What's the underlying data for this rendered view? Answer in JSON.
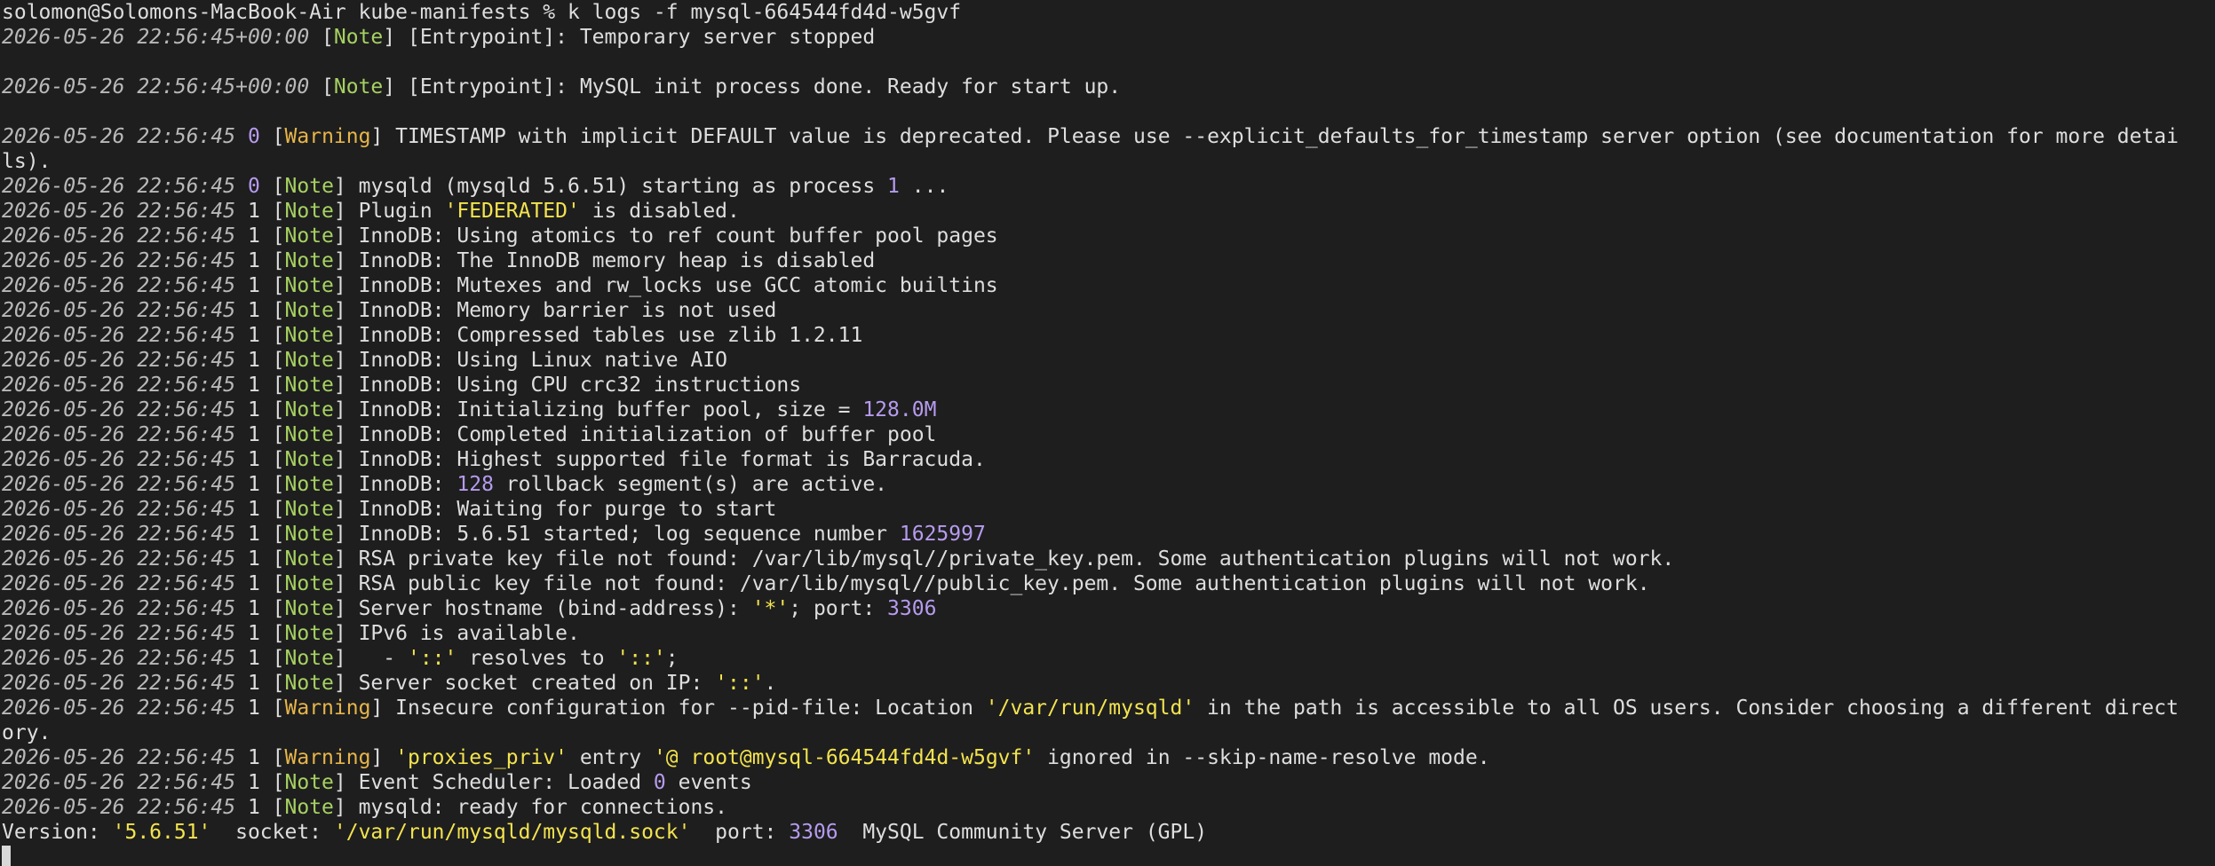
{
  "terminal": {
    "lines": [
      {
        "segments": [
          {
            "t": "text",
            "v": "solomon@Solomons-MacBook-Air kube-manifests % k logs -f mysql-664544fd4d-w5gvf"
          }
        ]
      },
      {
        "segments": [
          {
            "t": "ts",
            "v": "2026-05-26 22:56:45+00:00"
          },
          {
            "t": "text",
            "v": " ["
          },
          {
            "t": "note",
            "v": "Note"
          },
          {
            "t": "text",
            "v": "] [Entrypoint]: Temporary server stopped"
          }
        ]
      },
      {
        "segments": []
      },
      {
        "segments": [
          {
            "t": "ts",
            "v": "2026-05-26 22:56:45+00:00"
          },
          {
            "t": "text",
            "v": " ["
          },
          {
            "t": "note",
            "v": "Note"
          },
          {
            "t": "text",
            "v": "] [Entrypoint]: MySQL init process done. Ready for start up."
          }
        ]
      },
      {
        "segments": []
      },
      {
        "segments": [
          {
            "t": "ts",
            "v": "2026-05-26 22:56:45"
          },
          {
            "t": "text",
            "v": " "
          },
          {
            "t": "num",
            "v": "0"
          },
          {
            "t": "text",
            "v": " ["
          },
          {
            "t": "warn",
            "v": "Warning"
          },
          {
            "t": "text",
            "v": "] TIMESTAMP with implicit DEFAULT value is deprecated. Please use --explicit_defaults_for_timestamp server option (see documentation for more detai"
          }
        ]
      },
      {
        "segments": [
          {
            "t": "text",
            "v": "ls)."
          }
        ]
      },
      {
        "segments": [
          {
            "t": "ts",
            "v": "2026-05-26 22:56:45"
          },
          {
            "t": "text",
            "v": " "
          },
          {
            "t": "num",
            "v": "0"
          },
          {
            "t": "text",
            "v": " ["
          },
          {
            "t": "note",
            "v": "Note"
          },
          {
            "t": "text",
            "v": "] mysqld (mysqld 5.6.51) starting as process "
          },
          {
            "t": "num",
            "v": "1"
          },
          {
            "t": "text",
            "v": " ..."
          }
        ]
      },
      {
        "segments": [
          {
            "t": "ts",
            "v": "2026-05-26 22:56:45"
          },
          {
            "t": "text",
            "v": " 1 ["
          },
          {
            "t": "note",
            "v": "Note"
          },
          {
            "t": "text",
            "v": "] Plugin "
          },
          {
            "t": "str",
            "v": "'FEDERATED'"
          },
          {
            "t": "text",
            "v": " is disabled."
          }
        ]
      },
      {
        "segments": [
          {
            "t": "ts",
            "v": "2026-05-26 22:56:45"
          },
          {
            "t": "text",
            "v": " 1 ["
          },
          {
            "t": "note",
            "v": "Note"
          },
          {
            "t": "text",
            "v": "] InnoDB: Using atomics to ref count buffer pool pages"
          }
        ]
      },
      {
        "segments": [
          {
            "t": "ts",
            "v": "2026-05-26 22:56:45"
          },
          {
            "t": "text",
            "v": " 1 ["
          },
          {
            "t": "note",
            "v": "Note"
          },
          {
            "t": "text",
            "v": "] InnoDB: The InnoDB memory heap is disabled"
          }
        ]
      },
      {
        "segments": [
          {
            "t": "ts",
            "v": "2026-05-26 22:56:45"
          },
          {
            "t": "text",
            "v": " 1 ["
          },
          {
            "t": "note",
            "v": "Note"
          },
          {
            "t": "text",
            "v": "] InnoDB: Mutexes and rw_locks use GCC atomic builtins"
          }
        ]
      },
      {
        "segments": [
          {
            "t": "ts",
            "v": "2026-05-26 22:56:45"
          },
          {
            "t": "text",
            "v": " 1 ["
          },
          {
            "t": "note",
            "v": "Note"
          },
          {
            "t": "text",
            "v": "] InnoDB: Memory barrier is not used"
          }
        ]
      },
      {
        "segments": [
          {
            "t": "ts",
            "v": "2026-05-26 22:56:45"
          },
          {
            "t": "text",
            "v": " 1 ["
          },
          {
            "t": "note",
            "v": "Note"
          },
          {
            "t": "text",
            "v": "] InnoDB: Compressed tables use zlib 1.2.11"
          }
        ]
      },
      {
        "segments": [
          {
            "t": "ts",
            "v": "2026-05-26 22:56:45"
          },
          {
            "t": "text",
            "v": " 1 ["
          },
          {
            "t": "note",
            "v": "Note"
          },
          {
            "t": "text",
            "v": "] InnoDB: Using Linux native AIO"
          }
        ]
      },
      {
        "segments": [
          {
            "t": "ts",
            "v": "2026-05-26 22:56:45"
          },
          {
            "t": "text",
            "v": " 1 ["
          },
          {
            "t": "note",
            "v": "Note"
          },
          {
            "t": "text",
            "v": "] InnoDB: Using CPU crc32 instructions"
          }
        ]
      },
      {
        "segments": [
          {
            "t": "ts",
            "v": "2026-05-26 22:56:45"
          },
          {
            "t": "text",
            "v": " 1 ["
          },
          {
            "t": "note",
            "v": "Note"
          },
          {
            "t": "text",
            "v": "] InnoDB: Initializing buffer pool, size = "
          },
          {
            "t": "num",
            "v": "128.0M"
          }
        ]
      },
      {
        "segments": [
          {
            "t": "ts",
            "v": "2026-05-26 22:56:45"
          },
          {
            "t": "text",
            "v": " 1 ["
          },
          {
            "t": "note",
            "v": "Note"
          },
          {
            "t": "text",
            "v": "] InnoDB: Completed initialization of buffer pool"
          }
        ]
      },
      {
        "segments": [
          {
            "t": "ts",
            "v": "2026-05-26 22:56:45"
          },
          {
            "t": "text",
            "v": " 1 ["
          },
          {
            "t": "note",
            "v": "Note"
          },
          {
            "t": "text",
            "v": "] InnoDB: Highest supported file format is Barracuda."
          }
        ]
      },
      {
        "segments": [
          {
            "t": "ts",
            "v": "2026-05-26 22:56:45"
          },
          {
            "t": "text",
            "v": " 1 ["
          },
          {
            "t": "note",
            "v": "Note"
          },
          {
            "t": "text",
            "v": "] InnoDB: "
          },
          {
            "t": "num",
            "v": "128"
          },
          {
            "t": "text",
            "v": " rollback segment(s) are active."
          }
        ]
      },
      {
        "segments": [
          {
            "t": "ts",
            "v": "2026-05-26 22:56:45"
          },
          {
            "t": "text",
            "v": " 1 ["
          },
          {
            "t": "note",
            "v": "Note"
          },
          {
            "t": "text",
            "v": "] InnoDB: Waiting for purge to start"
          }
        ]
      },
      {
        "segments": [
          {
            "t": "ts",
            "v": "2026-05-26 22:56:45"
          },
          {
            "t": "text",
            "v": " 1 ["
          },
          {
            "t": "note",
            "v": "Note"
          },
          {
            "t": "text",
            "v": "] InnoDB: 5.6.51 started; log sequence number "
          },
          {
            "t": "num",
            "v": "1625997"
          }
        ]
      },
      {
        "segments": [
          {
            "t": "ts",
            "v": "2026-05-26 22:56:45"
          },
          {
            "t": "text",
            "v": " 1 ["
          },
          {
            "t": "note",
            "v": "Note"
          },
          {
            "t": "text",
            "v": "] RSA private key file not found: /var/lib/mysql//private_key.pem. Some authentication plugins will not work."
          }
        ]
      },
      {
        "segments": [
          {
            "t": "ts",
            "v": "2026-05-26 22:56:45"
          },
          {
            "t": "text",
            "v": " 1 ["
          },
          {
            "t": "note",
            "v": "Note"
          },
          {
            "t": "text",
            "v": "] RSA public key file not found: /var/lib/mysql//public_key.pem. Some authentication plugins will not work."
          }
        ]
      },
      {
        "segments": [
          {
            "t": "ts",
            "v": "2026-05-26 22:56:45"
          },
          {
            "t": "text",
            "v": " 1 ["
          },
          {
            "t": "note",
            "v": "Note"
          },
          {
            "t": "text",
            "v": "] Server hostname (bind-address): "
          },
          {
            "t": "str",
            "v": "'*'"
          },
          {
            "t": "text",
            "v": "; port: "
          },
          {
            "t": "num",
            "v": "3306"
          }
        ]
      },
      {
        "segments": [
          {
            "t": "ts",
            "v": "2026-05-26 22:56:45"
          },
          {
            "t": "text",
            "v": " 1 ["
          },
          {
            "t": "note",
            "v": "Note"
          },
          {
            "t": "text",
            "v": "] IPv6 is available."
          }
        ]
      },
      {
        "segments": [
          {
            "t": "ts",
            "v": "2026-05-26 22:56:45"
          },
          {
            "t": "text",
            "v": " 1 ["
          },
          {
            "t": "note",
            "v": "Note"
          },
          {
            "t": "text",
            "v": "]   - "
          },
          {
            "t": "str",
            "v": "'::'"
          },
          {
            "t": "text",
            "v": " resolves to "
          },
          {
            "t": "str",
            "v": "'::'"
          },
          {
            "t": "text",
            "v": ";"
          }
        ]
      },
      {
        "segments": [
          {
            "t": "ts",
            "v": "2026-05-26 22:56:45"
          },
          {
            "t": "text",
            "v": " 1 ["
          },
          {
            "t": "note",
            "v": "Note"
          },
          {
            "t": "text",
            "v": "] Server socket created on IP: "
          },
          {
            "t": "str",
            "v": "'::'"
          },
          {
            "t": "text",
            "v": "."
          }
        ]
      },
      {
        "segments": [
          {
            "t": "ts",
            "v": "2026-05-26 22:56:45"
          },
          {
            "t": "text",
            "v": " 1 ["
          },
          {
            "t": "warn",
            "v": "Warning"
          },
          {
            "t": "text",
            "v": "] Insecure configuration for --pid-file: Location "
          },
          {
            "t": "str",
            "v": "'/var/run/mysqld'"
          },
          {
            "t": "text",
            "v": " in the path is accessible to all OS users. Consider choosing a different direct"
          }
        ]
      },
      {
        "segments": [
          {
            "t": "text",
            "v": "ory."
          }
        ]
      },
      {
        "segments": [
          {
            "t": "ts",
            "v": "2026-05-26 22:56:45"
          },
          {
            "t": "text",
            "v": " 1 ["
          },
          {
            "t": "warn",
            "v": "Warning"
          },
          {
            "t": "text",
            "v": "] "
          },
          {
            "t": "str",
            "v": "'proxies_priv'"
          },
          {
            "t": "text",
            "v": " entry "
          },
          {
            "t": "str",
            "v": "'@ root@mysql-664544fd4d-w5gvf'"
          },
          {
            "t": "text",
            "v": " ignored in --skip-name-resolve mode."
          }
        ]
      },
      {
        "segments": [
          {
            "t": "ts",
            "v": "2026-05-26 22:56:45"
          },
          {
            "t": "text",
            "v": " 1 ["
          },
          {
            "t": "note",
            "v": "Note"
          },
          {
            "t": "text",
            "v": "] Event Scheduler: Loaded "
          },
          {
            "t": "num",
            "v": "0"
          },
          {
            "t": "text",
            "v": " events"
          }
        ]
      },
      {
        "segments": [
          {
            "t": "ts",
            "v": "2026-05-26 22:56:45"
          },
          {
            "t": "text",
            "v": " 1 ["
          },
          {
            "t": "note",
            "v": "Note"
          },
          {
            "t": "text",
            "v": "] mysqld: ready for connections."
          }
        ]
      },
      {
        "segments": [
          {
            "t": "text",
            "v": "Version: "
          },
          {
            "t": "str",
            "v": "'5.6.51'"
          },
          {
            "t": "text",
            "v": "  socket: "
          },
          {
            "t": "str",
            "v": "'/var/run/mysqld/mysqld.sock'"
          },
          {
            "t": "text",
            "v": "  port: "
          },
          {
            "t": "num",
            "v": "3306"
          },
          {
            "t": "text",
            "v": "  MySQL Community Server (GPL)"
          }
        ]
      }
    ]
  }
}
